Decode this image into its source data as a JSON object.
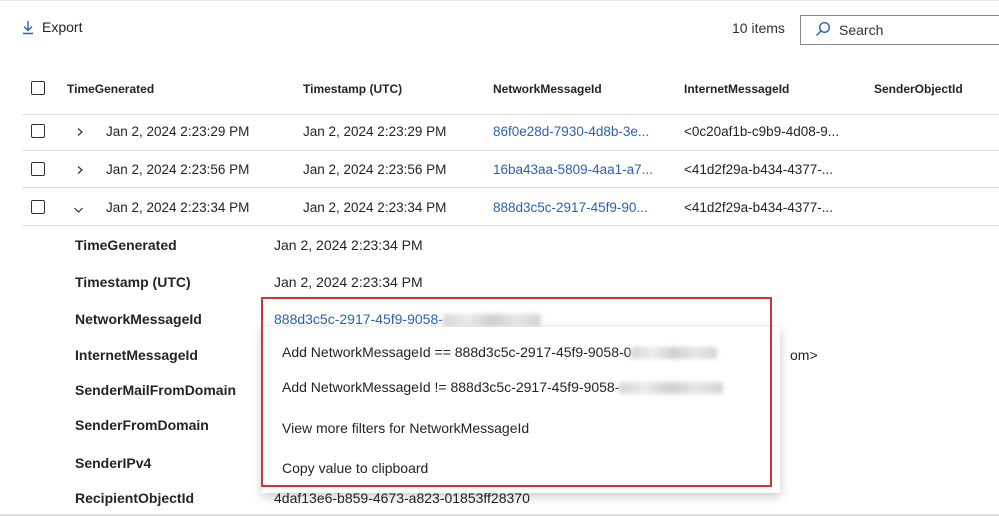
{
  "toolbar": {
    "export_label": "Export",
    "item_count": "10 items",
    "search_placeholder": "Search"
  },
  "table": {
    "columns": [
      "TimeGenerated",
      "Timestamp (UTC)",
      "NetworkMessageId",
      "InternetMessageId",
      "SenderObjectId"
    ],
    "rows": [
      {
        "time_generated": "Jan 2, 2024 2:23:29 PM",
        "timestamp": "Jan 2, 2024 2:23:29 PM",
        "network_message_id": "86f0e28d-7930-4d8b-3e...",
        "internet_message_id": "<0c20af1b-c9b9-4d08-9...",
        "expanded": false
      },
      {
        "time_generated": "Jan 2, 2024 2:23:56 PM",
        "timestamp": "Jan 2, 2024 2:23:56 PM",
        "network_message_id": "16ba43aa-5809-4aa1-a7...",
        "internet_message_id": "<41d2f29a-b434-4377-...",
        "expanded": false
      },
      {
        "time_generated": "Jan 2, 2024 2:23:34 PM",
        "timestamp": "Jan 2, 2024 2:23:34 PM",
        "network_message_id": "888d3c5c-2917-45f9-90...",
        "internet_message_id": "<41d2f29a-b434-4377-...",
        "expanded": true
      }
    ]
  },
  "details": [
    {
      "label": "TimeGenerated",
      "value": "Jan 2, 2024 2:23:34 PM"
    },
    {
      "label": "Timestamp (UTC)",
      "value": "Jan 2, 2024 2:23:34 PM"
    },
    {
      "label": "NetworkMessageId",
      "value": "888d3c5c-2917-45f9-9058-"
    },
    {
      "label": "InternetMessageId",
      "value": "",
      "value_tail": "om>"
    },
    {
      "label": "SenderMailFromDomain",
      "value": ""
    },
    {
      "label": "SenderFromDomain",
      "value": ""
    },
    {
      "label": "SenderIPv4",
      "value": ""
    },
    {
      "label": "RecipientObjectId",
      "value": "4daf13e6-b859-4673-a823-01853ff28370"
    }
  ],
  "context_menu": {
    "items": [
      "Add NetworkMessageId == 888d3c5c-2917-45f9-9058-0",
      "Add NetworkMessageId != 888d3c5c-2917-45f9-9058-",
      "View more filters for NetworkMessageId",
      "Copy value to clipboard"
    ]
  },
  "colors": {
    "link": "#2b62b3",
    "highlight_border": "#d13438"
  },
  "icons": {
    "export": "download-arrow-icon",
    "search": "search-icon",
    "collapsed": "chevron-right-icon",
    "expanded": "chevron-down-icon"
  }
}
